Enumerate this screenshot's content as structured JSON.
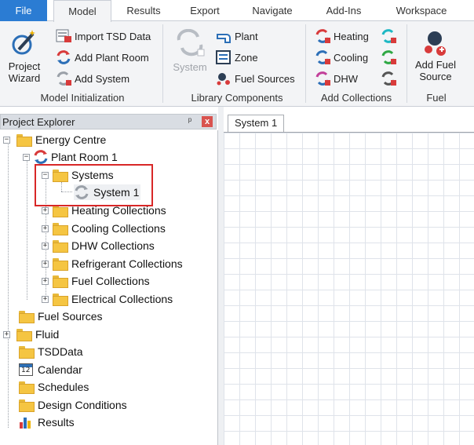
{
  "tabs": [
    "File",
    "Model",
    "Results",
    "Export",
    "Navigate",
    "Add-Ins",
    "Workspace"
  ],
  "ribbon": {
    "model_initialization": {
      "project_wizard": "Project\nWizard",
      "import_tsd": "Import TSD Data",
      "add_plant_room": "Add Plant Room",
      "add_system": "Add System",
      "label": "Model Initialization"
    },
    "library_components": {
      "system": "System",
      "plant": "Plant",
      "zone": "Zone",
      "fuel_sources": "Fuel Sources",
      "label": "Library Components"
    },
    "add_collections": {
      "heating": "Heating",
      "cooling": "Cooling",
      "dhw": "DHW",
      "label": "Add Collections"
    },
    "fuel": {
      "add_fuel_source": "Add Fuel\nSource",
      "label": "Fuel"
    }
  },
  "project_explorer": {
    "title": "Project Explorer",
    "pin": "ᵖ",
    "close": "x",
    "tree": {
      "energy_centre": "Energy Centre",
      "plant_room": "Plant Room 1",
      "systems": "Systems",
      "system_1": "System 1",
      "heating_collections": "Heating Collections",
      "cooling_collections": "Cooling Collections",
      "dhw_collections": "DHW Collections",
      "refrigerant_collections": "Refrigerant Collections",
      "fuel_collections": "Fuel Collections",
      "electrical_collections": "Electrical Collections",
      "fuel_sources": "Fuel Sources",
      "fluid": "Fluid",
      "tsddata": "TSDData",
      "calendar": "Calendar",
      "calendar_day": "12",
      "schedules": "Schedules",
      "design_conditions": "Design Conditions",
      "results": "Results"
    }
  },
  "document": {
    "tab": "System 1"
  },
  "colors": {
    "file_tab": "#2b7cd3",
    "highlight": "#d82727",
    "folder": "#f5c542"
  }
}
